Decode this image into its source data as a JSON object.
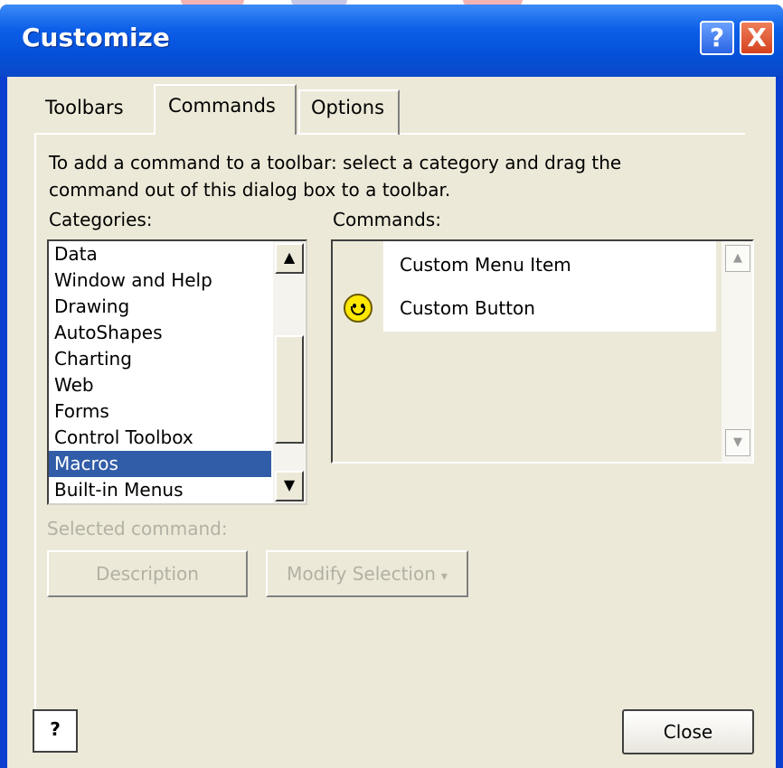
{
  "window": {
    "title": "Customize",
    "help_button": "?",
    "close_button": "X"
  },
  "tabs": [
    {
      "label": "Toolbars",
      "active": false
    },
    {
      "label": "Commands",
      "active": true
    },
    {
      "label": "Options",
      "active": false
    }
  ],
  "instructions": "To add a command to a toolbar: select a category and drag the command out of this dialog box to a toolbar.",
  "categories": {
    "label": "Categories:",
    "items": [
      "Data",
      "Window and Help",
      "Drawing",
      "AutoShapes",
      "Charting",
      "Web",
      "Forms",
      "Control Toolbox",
      "Macros",
      "Built-in Menus"
    ],
    "selected": "Macros"
  },
  "commands": {
    "label": "Commands:",
    "items": [
      {
        "label": "Custom Menu Item",
        "icon": "none"
      },
      {
        "label": "Custom Button",
        "icon": "smiley-icon"
      }
    ]
  },
  "selected_command": {
    "label": "Selected command:",
    "description_button": "Description",
    "modify_button": "Modify Selection"
  },
  "footer": {
    "help_icon_label": "?",
    "close_button": "Close"
  },
  "colors": {
    "titlebar": "#0550d8",
    "dialog_bg": "#ece9d8",
    "selection": "#315ca8",
    "close_red": "#d4411e"
  }
}
